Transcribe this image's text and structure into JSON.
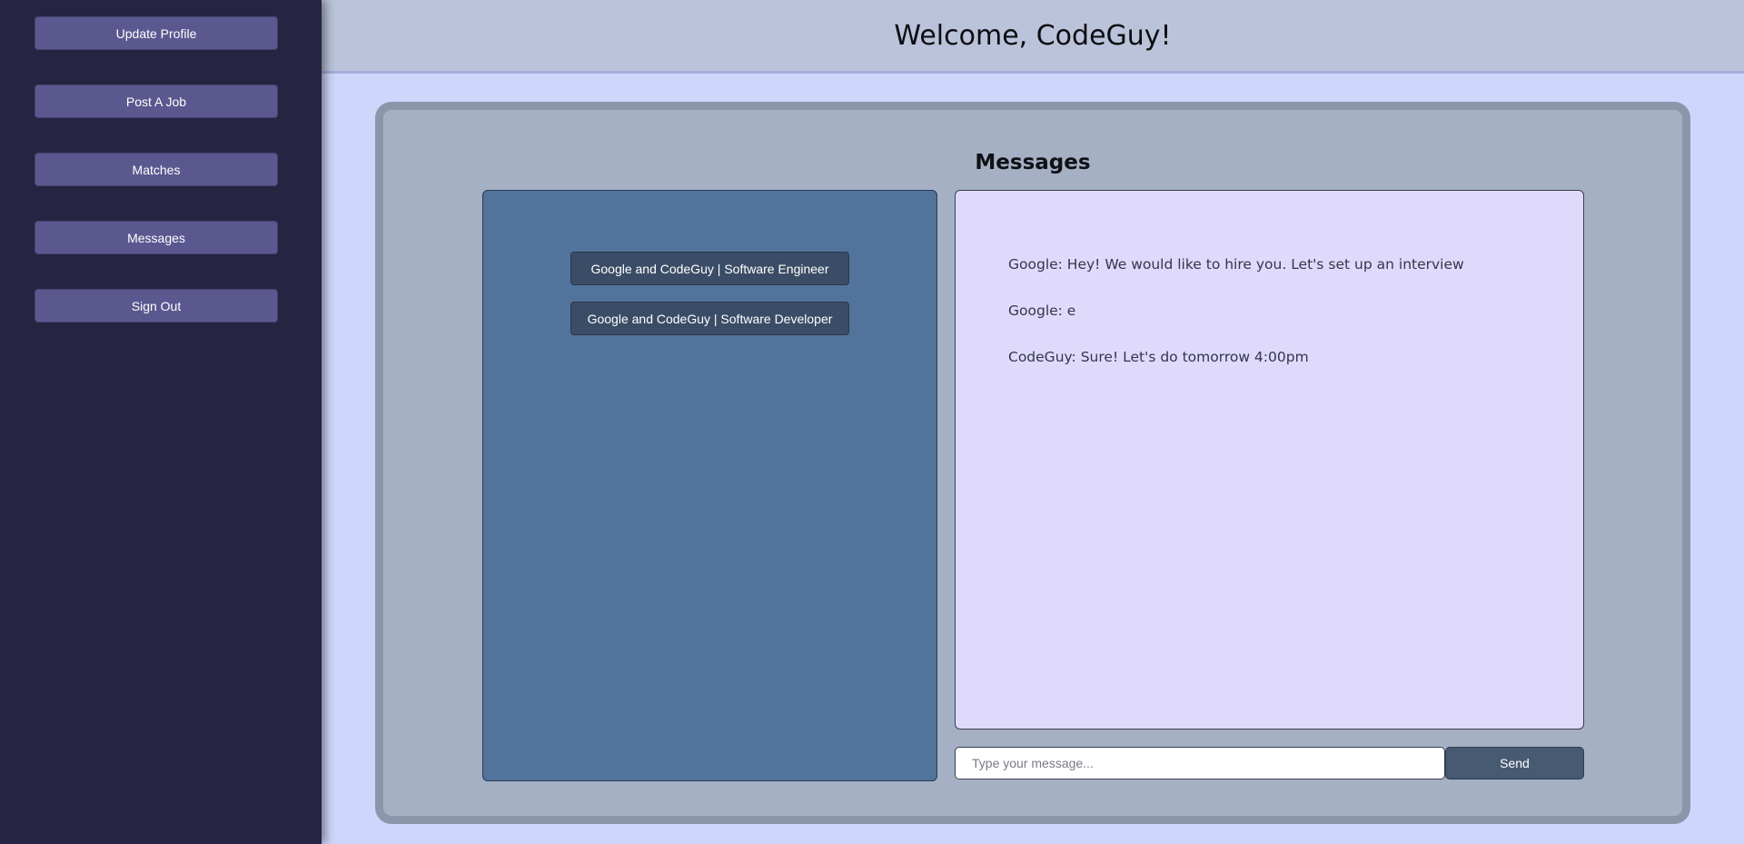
{
  "sidebar": {
    "items": [
      {
        "label": "Update Profile"
      },
      {
        "label": "Post A Job"
      },
      {
        "label": "Matches"
      },
      {
        "label": "Messages"
      },
      {
        "label": "Sign Out"
      }
    ]
  },
  "header": {
    "title": "Welcome, CodeGuy!"
  },
  "main": {
    "title": "Messages",
    "conversations": [
      {
        "label": "Google and CodeGuy | Software Engineer"
      },
      {
        "label": "Google and CodeGuy | Software Developer"
      }
    ],
    "messages": [
      {
        "text": "Google: Hey! We would like to hire you. Let's set up an interview"
      },
      {
        "text": "Google: e"
      },
      {
        "text": "CodeGuy: Sure! Let's do tomorrow 4:00pm"
      }
    ],
    "composer": {
      "placeholder": "Type your message...",
      "value": "",
      "send_label": "Send"
    }
  },
  "colors": {
    "sidebar_bg": "#272443",
    "nav_button": "#5b5890",
    "header_bg": "#bac3d9",
    "page_bg": "#cfd6fb",
    "card_bg": "#a5b0c4",
    "chat_list_bg": "#52739b",
    "messages_bg": "#dfdafc",
    "send_button": "#465a72"
  }
}
